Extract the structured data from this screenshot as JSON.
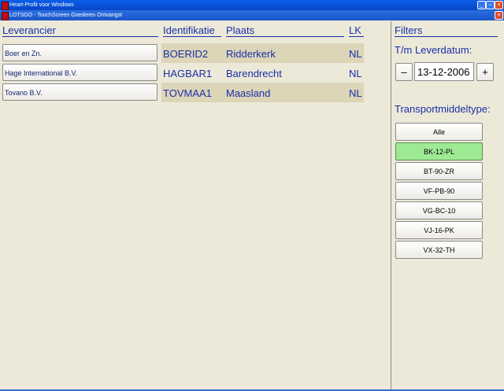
{
  "outer_window": {
    "title": "Heart-Profit voor Windows"
  },
  "inner_window": {
    "title": "LOTSGO - TouchScreen Goederen Ontvangst"
  },
  "table": {
    "headers": {
      "leverancier": "Leverancier",
      "identifikatie": "Identifikatie",
      "plaats": "Plaats",
      "lk": "LK"
    },
    "rows": [
      {
        "name": "Boer en Zn.",
        "id": "BOERID2",
        "plaats": "Ridderkerk",
        "lk": "NL"
      },
      {
        "name": "Hage International B.V.",
        "id": "HAGBAR1",
        "plaats": "Barendrecht",
        "lk": "NL"
      },
      {
        "name": "Tovano B.V.",
        "id": "TOVMAA1",
        "plaats": "Maasland",
        "lk": "NL"
      }
    ]
  },
  "filters": {
    "title": "Filters",
    "date_label": "T/m Leverdatum:",
    "decrement_label": "–",
    "date_value": "13-12-2006",
    "increment_label": "+",
    "transport_label": "Transportmiddeltype:",
    "transport_options": [
      "Alle",
      "BK-12-PL",
      "BT-90-ZR",
      "VF-PB-90",
      "VG-BC-10",
      "VJ-16-PK",
      "VX-32-TH"
    ],
    "selected_option": "BK-12-PL",
    "selected_color": "#9eea94"
  }
}
